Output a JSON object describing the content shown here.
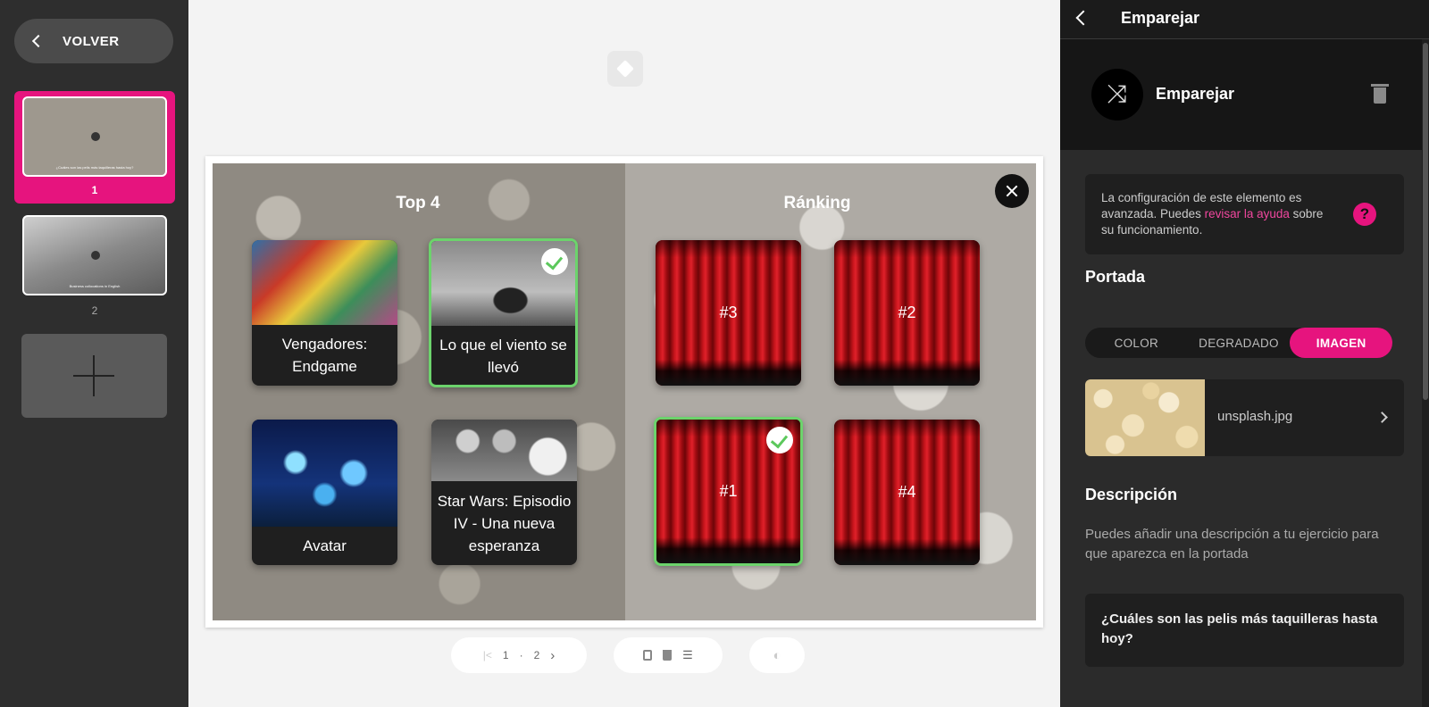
{
  "sidebar": {
    "back_label": "VOLVER",
    "slides": [
      {
        "number": "1",
        "caption": "¿Cuáles son las pelis más taquilleras hasta hoy?"
      },
      {
        "number": "2",
        "caption": "Business collocations in English"
      }
    ],
    "add_icon": "plus-icon"
  },
  "game": {
    "left_title": "Top 4",
    "right_title": "Ránking",
    "movies": [
      {
        "title": "Vengadores: Endgame",
        "selected": false
      },
      {
        "title": "Lo que el viento se llevó",
        "selected": true
      },
      {
        "title": "Avatar",
        "selected": false
      },
      {
        "title": "Star Wars: Episodio IV - Una nueva esperanza",
        "selected": false
      }
    ],
    "ranks": [
      {
        "label": "#3",
        "selected": false
      },
      {
        "label": "#2",
        "selected": false
      },
      {
        "label": "#1",
        "selected": true
      },
      {
        "label": "#4",
        "selected": false
      }
    ]
  },
  "toolbar": {
    "page_current": "1",
    "page_separator": "·",
    "page_total": "2"
  },
  "panel": {
    "header_title": "Emparejar",
    "element_name": "Emparejar",
    "info_text_before": "La configuración de este elemento es avanzada. Puedes ",
    "info_link": "revisar la ayuda",
    "info_text_after": " sobre su funcionamiento.",
    "help_symbol": "?",
    "cover_title": "Portada",
    "cover_tabs": [
      "COLOR",
      "DEGRADADO",
      "IMAGEN"
    ],
    "cover_active": "IMAGEN",
    "file_name": "unsplash.jpg",
    "description_title": "Descripción",
    "description_hint": "Puedes añadir una descripción a tu ejercicio para que aparezca en la portada",
    "question": "¿Cuáles son las pelis más taquilleras hasta hoy?"
  },
  "colors": {
    "accent": "#e6147e",
    "selected_border": "#6cd36c"
  }
}
